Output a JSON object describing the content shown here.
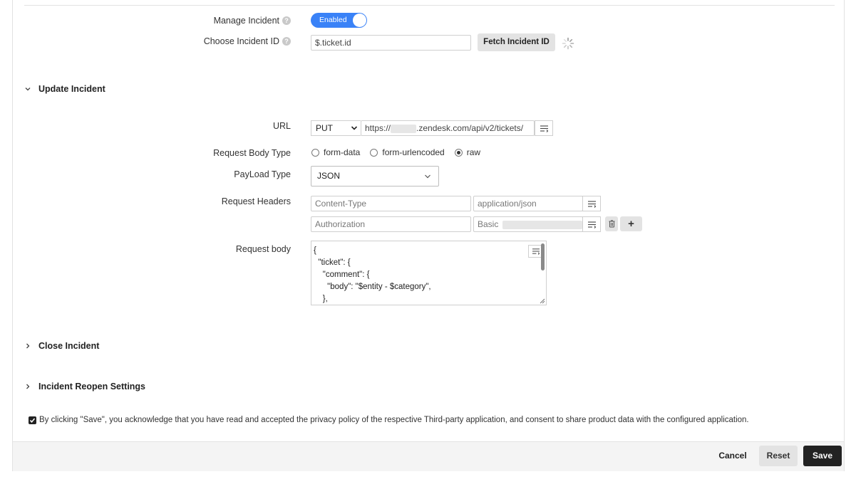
{
  "manage_incident": {
    "label": "Manage Incident",
    "help": "?",
    "toggle_text": "Enabled"
  },
  "choose_incident": {
    "label": "Choose Incident ID",
    "help": "?",
    "input_value": "$.ticket.id",
    "fetch_button": "Fetch Incident ID"
  },
  "update_section": {
    "title": "Update Incident"
  },
  "url": {
    "label": "URL",
    "method": "PUT",
    "prefix": "https://",
    "suffix": ".zendesk.com/api/v2/tickets/"
  },
  "request_body_type": {
    "label": "Request Body Type",
    "options": [
      "form-data",
      "form-urlencoded",
      "raw"
    ],
    "selected": "raw"
  },
  "payload_type": {
    "label": "PayLoad Type",
    "value": "JSON"
  },
  "request_headers": {
    "label": "Request Headers",
    "rows": [
      {
        "key": "Content-Type",
        "value": "application/json"
      },
      {
        "key": "Authorization",
        "value": "Basic"
      }
    ],
    "add_symbol": "+"
  },
  "request_body": {
    "label": "Request body",
    "content": "{\n  \"ticket\": {\n    \"comment\": {\n      \"body\": \"$entity - $category\",\n    },"
  },
  "close_section": {
    "title": "Close Incident"
  },
  "reopen_section": {
    "title": "Incident Reopen Settings"
  },
  "consent": {
    "checked": true,
    "text": "By clicking \"Save\", you acknowledge that you have read and accepted the privacy policy of the respective Third-party application, and consent to share product data with the configured application."
  },
  "footer": {
    "cancel": "Cancel",
    "reset": "Reset",
    "save": "Save"
  },
  "colors": {
    "accent": "#3a82f7",
    "save_bg": "#222222",
    "button_grey": "#e3e3e3"
  }
}
